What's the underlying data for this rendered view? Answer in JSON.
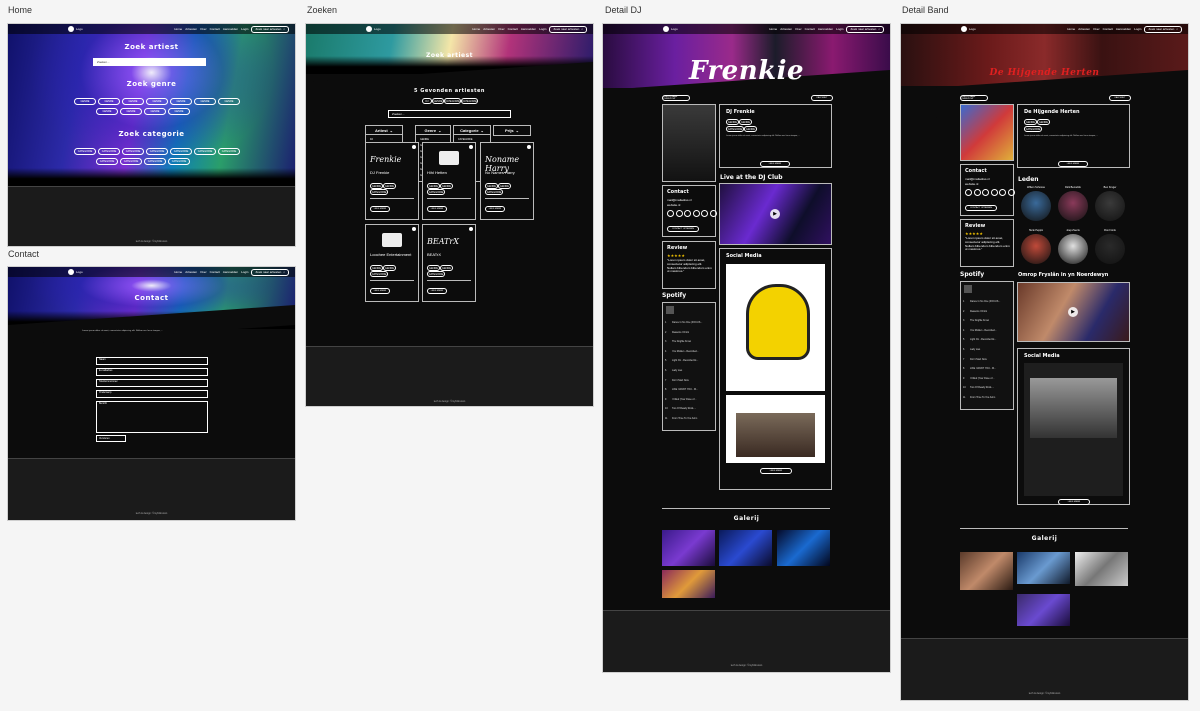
{
  "frames": {
    "home": "Home",
    "contact": "Contact",
    "zoeken": "Zoeken",
    "detail_dj": "Detail DJ",
    "detail_band": "Detail Band"
  },
  "nav": {
    "logo": "Logo",
    "links": [
      "Home",
      "Artiesten",
      "Over",
      "Contact",
      "Aanmelden",
      "Login"
    ],
    "search": "Zoek naar artiesten"
  },
  "home": {
    "zoek_artiest": "Zoek artiest",
    "search_value": "Zoeken...",
    "zoek_genre": "Zoek genre",
    "zoek_categorie": "Zoek categorie",
    "genre_chips": [
      "GENRE",
      "GENRE",
      "GENRE",
      "GENRE",
      "GENRE",
      "GENRE",
      "GENRE",
      "GENRE",
      "GENRE",
      "GENRE",
      "GENRE"
    ],
    "categorie_chips": [
      "CATEGORIE",
      "CATEGORIE",
      "CATEGORIE",
      "CATEGORIE",
      "CATEGORIE",
      "CATEGORIE",
      "CATEGORIE",
      "CATEGORIE",
      "CATEGORIE",
      "CATEGORIE",
      "CATEGORIE"
    ],
    "footer": "tech & design: ©mybitknown"
  },
  "contact": {
    "title": "Contact",
    "intro": "Lorem ipsum dolor sit amet, consectetur adipiscing elit. Nullam nec lacus tempor, ...",
    "fields": [
      "Naam",
      "E-mailadres",
      "Telefoonnummer",
      "Onderwerp",
      "Bericht"
    ],
    "submit": "Versturen",
    "footer": "tech & design: ©mybitknown"
  },
  "zoeken": {
    "title": "Zoek artiest",
    "result_count": "5 Gevonden artiesten",
    "filter_chips": [
      "DJ",
      "GENRE",
      "CATEGORIE",
      "CATEGORIE"
    ],
    "search_value": "Zoeken...",
    "filters": [
      "Artiest",
      "Genre",
      "Categorie",
      "Prijs"
    ],
    "artist_dropdown": [
      "DJ",
      "BAND",
      "Solo"
    ],
    "genre_dropdown": [
      "GENRE",
      "GENRE",
      "GENRE",
      "GENRE",
      "GENRE",
      "GENRE",
      "GENRE"
    ],
    "cat_dropdown": [
      "CATEGORIE",
      "CATEGORIE",
      "CATEGORIE",
      "CATEGORIE",
      "CATEGORIE",
      "CATEGORIE",
      "CATEGORIE"
    ],
    "cards": [
      {
        "name": "DJ Frenkie",
        "logo": "Frenkie"
      },
      {
        "name": "Hihl Hetten",
        "logo": ""
      },
      {
        "name": "No Names Harry",
        "logo": "Noname Harry"
      },
      {
        "name": "Loochee Entertainment",
        "logo": ""
      },
      {
        "name": "BEATrX",
        "logo": "BEATrX"
      }
    ],
    "card_chip": "GENRE",
    "card_cat": "CATEGORIE",
    "card_btn": "LEES MEER",
    "footer": "tech & design: ©mybitknown"
  },
  "dj": {
    "banner": "Frenkie",
    "back": "TERUG NAAR OVERZICHT",
    "fav": "FAVORIET",
    "name": "DJ Frenkie",
    "chips": [
      "GENRE",
      "GENRE",
      "CATEGORIE",
      "GENRE"
    ],
    "bio": "Lorem ipsum dolor sit amet, consectetur adipiscing elit. Nullam nec lacus tempor, ...",
    "more": "LEES MEER",
    "contact_h": "Contact",
    "mail": "mail@mailadres.nl",
    "website": "website.nl",
    "contact_btn": "CONTACT OPNEMEN",
    "review_h": "Review",
    "stars": "★★★★★",
    "quote": "\"Lorem ipsum dolor sit amet, consectetur adipiscing elit. Nullam bibendum bibendum enim ut maximus.\"",
    "spotify_h": "Spotify",
    "tracks": [
      "Dance In No One (FOCUS...",
      "Reasons I Drink",
      "The Dogfite Know",
      "You Ridden - Recorded...",
      "Light On - Recorded At...",
      "Lady Lies",
      "Don't Start Now",
      "LIKE I WANT YOU - M...",
      "I Killed (Your Dose of...",
      "Two Of Ready Rock-...",
      "From Time To You Anim"
    ],
    "live_h": "Live at the DJ Club",
    "social_h": "Social Media",
    "social_btn": "LEES MEER",
    "gallery_h": "Galerij",
    "footer": "tech & design: ©mybitknown"
  },
  "band": {
    "banner": "De Hijgende Herten",
    "back": "TERUG NAAR OVERZICHT",
    "fav": "FAVORIET",
    "name": "De Hijgende Herten",
    "chips": [
      "GENRE",
      "GENRE",
      "CATEGORIE"
    ],
    "bio": "Lorem ipsum dolor sit amet, consectetur adipiscing elit. Nullam nec lacus tempor, ...",
    "more": "LEES MEER",
    "contact_h": "Contact",
    "mail": "mail@mailadres.nl",
    "website": "website.nl",
    "contact_btn": "CONTACT OPNEMEN",
    "review_h": "Review",
    "stars": "★★★★★",
    "quote": "\"Lorem ipsum dolor sit amet, consectetur adipiscing elit. Nullam bibendum bibendum enim ut maximus.\"",
    "spotify_h": "Spotify",
    "leden_h": "Leden",
    "members": [
      "Willem Schoone",
      "Dick Bemelink",
      "Ben Kruger",
      "Henk Peppin",
      "Joep Zwerts",
      "Ron Fronk"
    ],
    "video_h": "Omrop Fryslân in yn Noerdewyn",
    "social_h": "Social Media",
    "social_btn": "LEES MEER",
    "gallery_h": "Galerij",
    "footer": "tech & design: ©mybitknown"
  }
}
